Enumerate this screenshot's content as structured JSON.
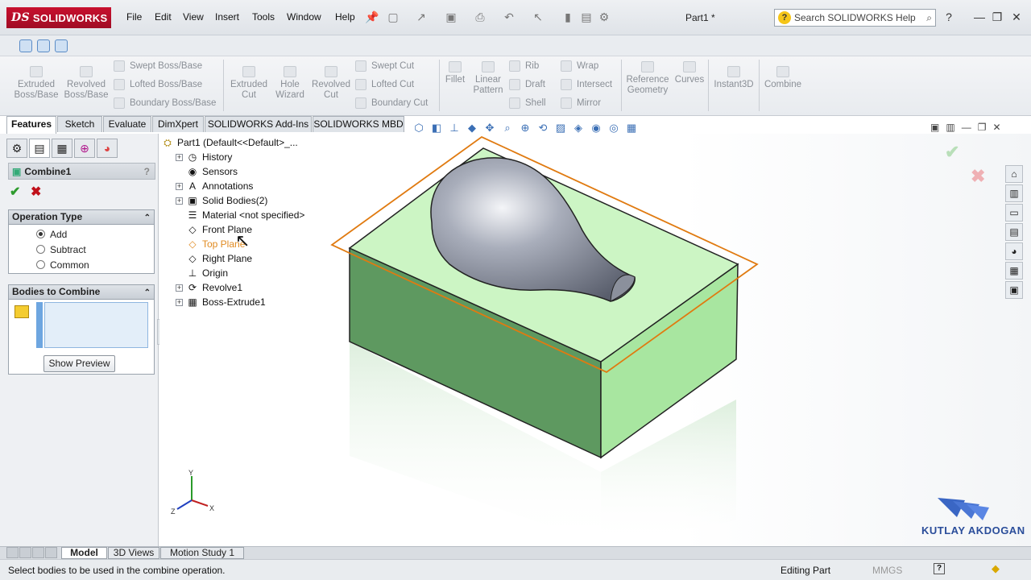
{
  "app": {
    "brand": "SOLIDWORKS",
    "doc_title": "Part1 *"
  },
  "menu": [
    "File",
    "Edit",
    "View",
    "Insert",
    "Tools",
    "Window",
    "Help"
  ],
  "search_placeholder": "Search SOLIDWORKS Help",
  "commands": {
    "extruded_boss": "Extruded Boss/Base",
    "revolved_boss": "Revolved Boss/Base",
    "swept_boss": "Swept Boss/Base",
    "lofted_boss": "Lofted Boss/Base",
    "boundary_boss": "Boundary Boss/Base",
    "extruded_cut": "Extruded Cut",
    "hole_wizard": "Hole Wizard",
    "revolved_cut": "Revolved Cut",
    "swept_cut": "Swept Cut",
    "lofted_cut": "Lofted Cut",
    "boundary_cut": "Boundary Cut",
    "fillet": "Fillet",
    "linear_pattern": "Linear Pattern",
    "rib": "Rib",
    "draft": "Draft",
    "shell": "Shell",
    "wrap": "Wrap",
    "intersect": "Intersect",
    "mirror": "Mirror",
    "reference_geometry": "Reference Geometry",
    "curves": "Curves",
    "instant3d": "Instant3D",
    "combine": "Combine"
  },
  "tabs": [
    "Features",
    "Sketch",
    "Evaluate",
    "DimXpert",
    "SOLIDWORKS Add-Ins",
    "SOLIDWORKS MBD"
  ],
  "property_manager": {
    "title": "Combine1",
    "help": "?",
    "operation_type": {
      "header": "Operation Type",
      "options": [
        "Add",
        "Subtract",
        "Common"
      ],
      "selected": "Add"
    },
    "bodies": {
      "header": "Bodies to Combine",
      "preview_button": "Show Preview"
    }
  },
  "tree": {
    "root": "Part1  (Default<<Default>_...",
    "items": [
      "History",
      "Sensors",
      "Annotations",
      "Solid Bodies(2)",
      "Material <not specified>",
      "Front Plane",
      "Top Plane",
      "Right Plane",
      "Origin",
      "Revolve1",
      "Boss-Extrude1"
    ]
  },
  "bottom_tabs": [
    "Model",
    "3D Views",
    "Motion Study 1"
  ],
  "status": {
    "message": "Select bodies to be used in the combine operation.",
    "mode": "Editing Part",
    "units": "MMGS",
    "help": "?"
  },
  "watermark": "KUTLAY AKDOGAN",
  "colors": {
    "brand": "#c8102e",
    "body_green": "#5a9a5a",
    "body_top": "#ccf5c4",
    "plane_orange": "#e07a10",
    "bulb": "#8a8f9a"
  }
}
